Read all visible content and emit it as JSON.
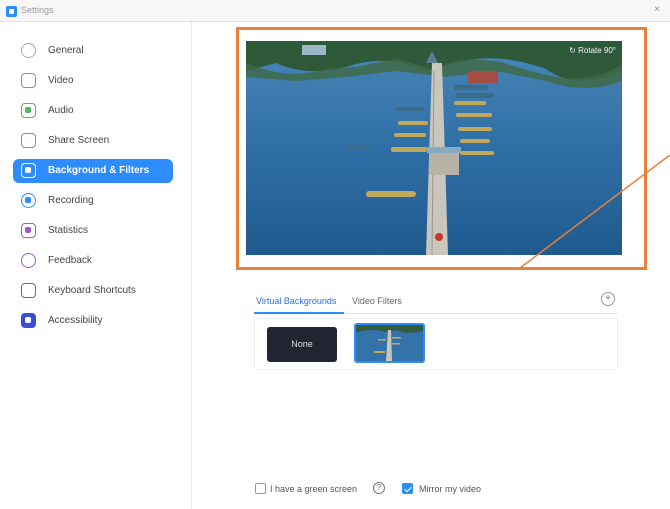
{
  "window": {
    "title": "Settings",
    "close_glyph": "×"
  },
  "colors": {
    "accent": "#2d8cff",
    "highlight_frame": "#e8813a",
    "sidebar_bg": "#ffffff"
  },
  "sidebar": {
    "items": [
      {
        "label": "General",
        "icon": "gear-icon",
        "icon_color": "#a7a7ad"
      },
      {
        "label": "Video",
        "icon": "camera-icon",
        "icon_color": "#4db85e"
      },
      {
        "label": "Audio",
        "icon": "headphones-icon",
        "icon_color": "#4db85e"
      },
      {
        "label": "Share Screen",
        "icon": "share-screen-icon",
        "icon_color": "#4db85e"
      },
      {
        "label": "Background & Filters",
        "icon": "background-icon",
        "icon_color": "#ffffff",
        "active": true
      },
      {
        "label": "Recording",
        "icon": "record-icon",
        "icon_color": "#2d8cff"
      },
      {
        "label": "Statistics",
        "icon": "statistics-icon",
        "icon_color": "#a259c9"
      },
      {
        "label": "Feedback",
        "icon": "feedback-icon",
        "icon_color": "#a259c9"
      },
      {
        "label": "Keyboard Shortcuts",
        "icon": "keyboard-icon",
        "icon_color": "#6b5bcf"
      },
      {
        "label": "Accessibility",
        "icon": "accessibility-icon",
        "icon_color": "#3d4fd1"
      }
    ]
  },
  "preview": {
    "rotate_label": "↻ Rotate 90°"
  },
  "tabs": [
    {
      "label": "Virtual Backgrounds",
      "active": true
    },
    {
      "label": "Video Filters",
      "active": false
    }
  ],
  "add_glyph": "+",
  "backgrounds": {
    "none_label": "None"
  },
  "options": {
    "green_screen_label": "I have a green screen",
    "green_screen_checked": false,
    "help_glyph": "?",
    "mirror_label": "Mirror my video",
    "mirror_checked": true
  }
}
